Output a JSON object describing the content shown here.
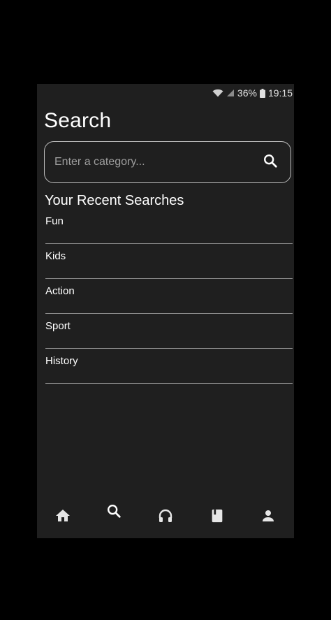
{
  "status_bar": {
    "battery": "36%",
    "time": "19:15",
    "icons": [
      "wifi-icon",
      "signal-icon",
      "battery-icon"
    ]
  },
  "page_title": "Search",
  "search": {
    "placeholder": "Enter a category...",
    "value": "",
    "icon": "search-icon"
  },
  "recent": {
    "title": "Your Recent Searches",
    "items": [
      "Fun",
      "Kids",
      "Action",
      "Sport",
      "History"
    ]
  },
  "nav": {
    "items": [
      "home-icon",
      "search-icon",
      "headphones-icon",
      "book-icon",
      "person-icon"
    ],
    "active": "search-icon"
  },
  "colors": {
    "background": "#1f1f1f",
    "text": "#ffffff",
    "divider": "#8a8a8a",
    "icon": "#e6e6e6"
  }
}
